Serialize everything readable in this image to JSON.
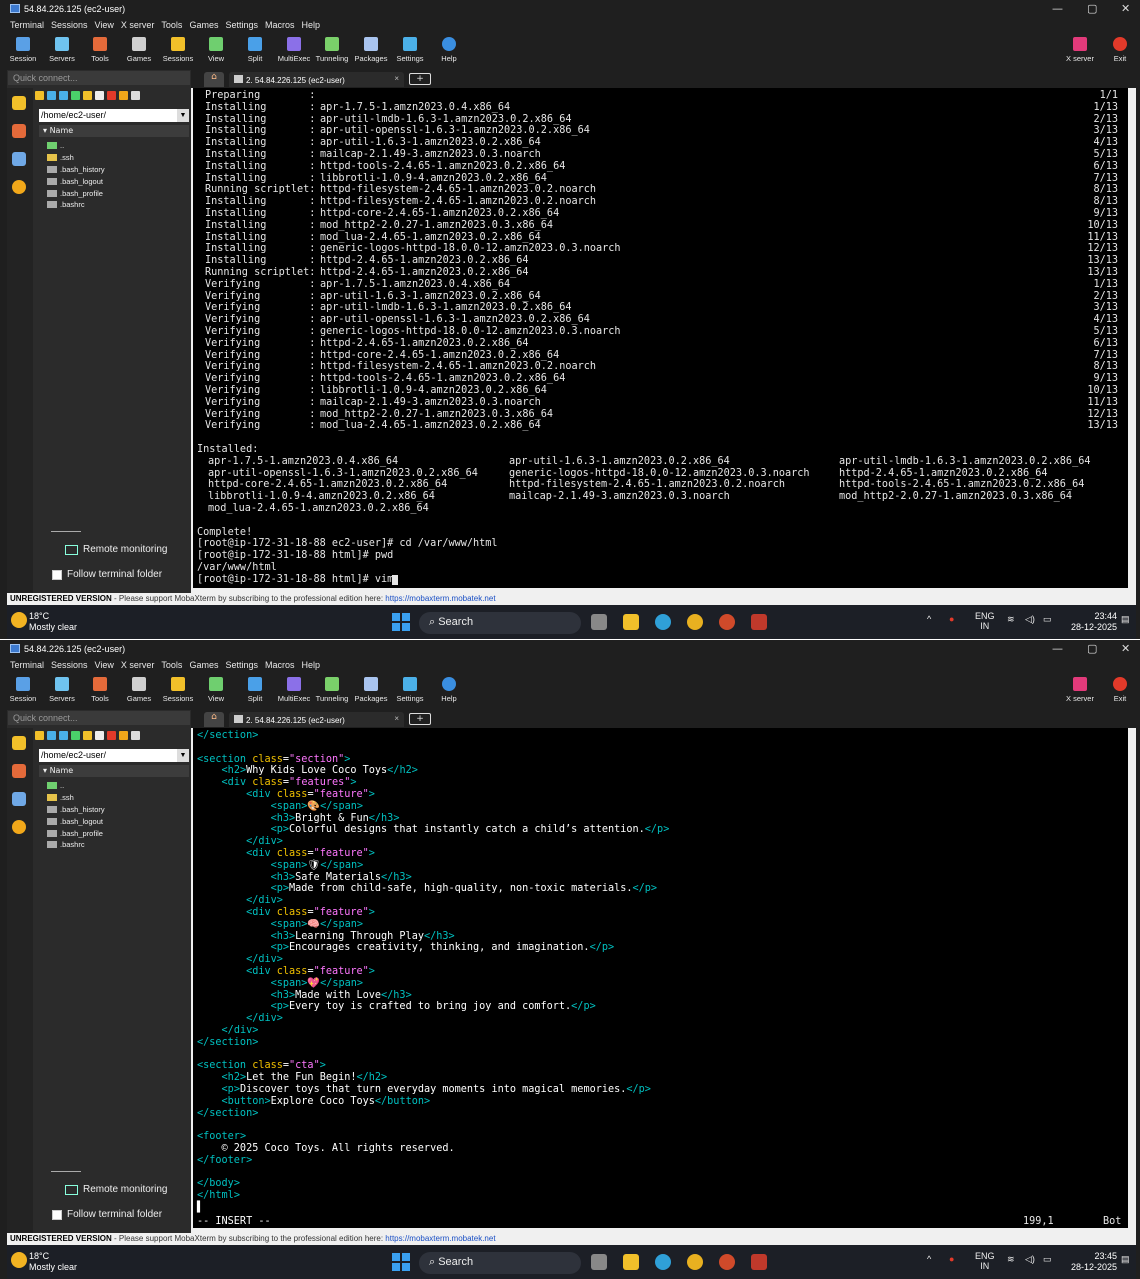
{
  "window": {
    "title": "54.84.226.125 (ec2-user)",
    "min": "—",
    "max": "▢",
    "close": "✕"
  },
  "menu": [
    "Terminal",
    "Sessions",
    "View",
    "X server",
    "Tools",
    "Games",
    "Settings",
    "Macros",
    "Help"
  ],
  "toolbar": {
    "items": [
      {
        "label": "Session",
        "icon": "session-icon",
        "color": "#5aa0e6"
      },
      {
        "label": "Servers",
        "icon": "servers-icon",
        "color": "#6fc3ef"
      },
      {
        "label": "Tools",
        "icon": "tools-icon",
        "color": "#e46a3a"
      },
      {
        "label": "Games",
        "icon": "games-icon",
        "color": "#cfcfcf"
      },
      {
        "label": "Sessions",
        "icon": "star-icon",
        "color": "#f2c02a"
      },
      {
        "label": "View",
        "icon": "view-icon",
        "color": "#6fcf6f"
      },
      {
        "label": "Split",
        "icon": "split-icon",
        "color": "#4aa0e8"
      },
      {
        "label": "MultiExec",
        "icon": "multiexec-icon",
        "color": "#8b70e8"
      },
      {
        "label": "Tunneling",
        "icon": "tunneling-icon",
        "color": "#7ad06a"
      },
      {
        "label": "Packages",
        "icon": "packages-icon",
        "color": "#a9c4ef"
      },
      {
        "label": "Settings",
        "icon": "settings-icon",
        "color": "#4bb0e8"
      },
      {
        "label": "Help",
        "icon": "help-icon",
        "color": "#3a8ee0"
      }
    ],
    "xserver": "X server",
    "exit": "Exit"
  },
  "sidebar": {
    "quick_connect": "Quick connect...",
    "path": "/home/ec2-user/",
    "name_col": "Name",
    "files": [
      "..",
      ".ssh",
      ".bash_history",
      ".bash_logout",
      ".bash_profile",
      ".bashrc"
    ],
    "remote_monitoring": "Remote monitoring",
    "follow_folder": "Follow terminal folder"
  },
  "tab": {
    "label": "2. 54.84.226.125 (ec2-user)",
    "close": "×",
    "plus": "+"
  },
  "banner": {
    "bold": "UNREGISTERED VERSION",
    "text": " -  Please support MobaXterm by subscribing to the professional edition here:  ",
    "link": "https://mobaxterm.mobatek.net"
  },
  "taskbar": {
    "temp": "18°C",
    "weather": "Mostly clear",
    "search": "Search",
    "lang1": "ENG",
    "lang2": "IN",
    "time1": "23:44",
    "time2": "23:45",
    "date": "28-12-2025"
  },
  "term1": {
    "rows": [
      {
        "a": "Preparing        :",
        "b": "",
        "c": "1/1"
      },
      {
        "a": "Installing       :",
        "b": "apr-1.7.5-1.amzn2023.0.4.x86_64",
        "c": "1/13"
      },
      {
        "a": "Installing       :",
        "b": "apr-util-lmdb-1.6.3-1.amzn2023.0.2.x86_64",
        "c": "2/13"
      },
      {
        "a": "Installing       :",
        "b": "apr-util-openssl-1.6.3-1.amzn2023.0.2.x86_64",
        "c": "3/13"
      },
      {
        "a": "Installing       :",
        "b": "apr-util-1.6.3-1.amzn2023.0.2.x86_64",
        "c": "4/13"
      },
      {
        "a": "Installing       :",
        "b": "mailcap-2.1.49-3.amzn2023.0.3.noarch",
        "c": "5/13"
      },
      {
        "a": "Installing       :",
        "b": "httpd-tools-2.4.65-1.amzn2023.0.2.x86_64",
        "c": "6/13"
      },
      {
        "a": "Installing       :",
        "b": "libbrotli-1.0.9-4.amzn2023.0.2.x86_64",
        "c": "7/13"
      },
      {
        "a": "Running scriptlet:",
        "b": "httpd-filesystem-2.4.65-1.amzn2023.0.2.noarch",
        "c": "8/13"
      },
      {
        "a": "Installing       :",
        "b": "httpd-filesystem-2.4.65-1.amzn2023.0.2.noarch",
        "c": "8/13"
      },
      {
        "a": "Installing       :",
        "b": "httpd-core-2.4.65-1.amzn2023.0.2.x86_64",
        "c": "9/13"
      },
      {
        "a": "Installing       :",
        "b": "mod_http2-2.0.27-1.amzn2023.0.3.x86_64",
        "c": "10/13"
      },
      {
        "a": "Installing       :",
        "b": "mod_lua-2.4.65-1.amzn2023.0.2.x86_64",
        "c": "11/13"
      },
      {
        "a": "Installing       :",
        "b": "generic-logos-httpd-18.0.0-12.amzn2023.0.3.noarch",
        "c": "12/13"
      },
      {
        "a": "Installing       :",
        "b": "httpd-2.4.65-1.amzn2023.0.2.x86_64",
        "c": "13/13"
      },
      {
        "a": "Running scriptlet:",
        "b": "httpd-2.4.65-1.amzn2023.0.2.x86_64",
        "c": "13/13"
      },
      {
        "a": "Verifying        :",
        "b": "apr-1.7.5-1.amzn2023.0.4.x86_64",
        "c": "1/13"
      },
      {
        "a": "Verifying        :",
        "b": "apr-util-1.6.3-1.amzn2023.0.2.x86_64",
        "c": "2/13"
      },
      {
        "a": "Verifying        :",
        "b": "apr-util-lmdb-1.6.3-1.amzn2023.0.2.x86_64",
        "c": "3/13"
      },
      {
        "a": "Verifying        :",
        "b": "apr-util-openssl-1.6.3-1.amzn2023.0.2.x86_64",
        "c": "4/13"
      },
      {
        "a": "Verifying        :",
        "b": "generic-logos-httpd-18.0.0-12.amzn2023.0.3.noarch",
        "c": "5/13"
      },
      {
        "a": "Verifying        :",
        "b": "httpd-2.4.65-1.amzn2023.0.2.x86_64",
        "c": "6/13"
      },
      {
        "a": "Verifying        :",
        "b": "httpd-core-2.4.65-1.amzn2023.0.2.x86_64",
        "c": "7/13"
      },
      {
        "a": "Verifying        :",
        "b": "httpd-filesystem-2.4.65-1.amzn2023.0.2.noarch",
        "c": "8/13"
      },
      {
        "a": "Verifying        :",
        "b": "httpd-tools-2.4.65-1.amzn2023.0.2.x86_64",
        "c": "9/13"
      },
      {
        "a": "Verifying        :",
        "b": "libbrotli-1.0.9-4.amzn2023.0.2.x86_64",
        "c": "10/13"
      },
      {
        "a": "Verifying        :",
        "b": "mailcap-2.1.49-3.amzn2023.0.3.noarch",
        "c": "11/13"
      },
      {
        "a": "Verifying        :",
        "b": "mod_http2-2.0.27-1.amzn2023.0.3.x86_64",
        "c": "12/13"
      },
      {
        "a": "Verifying        :",
        "b": "mod_lua-2.4.65-1.amzn2023.0.2.x86_64",
        "c": "13/13"
      }
    ],
    "installed_label": "Installed:",
    "installed": [
      [
        "apr-1.7.5-1.amzn2023.0.4.x86_64",
        "apr-util-1.6.3-1.amzn2023.0.2.x86_64",
        "apr-util-lmdb-1.6.3-1.amzn2023.0.2.x86_64"
      ],
      [
        "apr-util-openssl-1.6.3-1.amzn2023.0.2.x86_64",
        "generic-logos-httpd-18.0.0-12.amzn2023.0.3.noarch",
        "httpd-2.4.65-1.amzn2023.0.2.x86_64"
      ],
      [
        "httpd-core-2.4.65-1.amzn2023.0.2.x86_64",
        "httpd-filesystem-2.4.65-1.amzn2023.0.2.noarch",
        "httpd-tools-2.4.65-1.amzn2023.0.2.x86_64"
      ],
      [
        "libbrotli-1.0.9-4.amzn2023.0.2.x86_64",
        "mailcap-2.1.49-3.amzn2023.0.3.noarch",
        "mod_http2-2.0.27-1.amzn2023.0.3.x86_64"
      ],
      [
        "mod_lua-2.4.65-1.amzn2023.0.2.x86_64",
        "",
        ""
      ]
    ],
    "tail": [
      "Complete!",
      "[root@ip-172-31-18-88 ec2-user]# cd /var/www/html",
      "[root@ip-172-31-18-88 html]# pwd",
      "/var/www/html",
      "[root@ip-172-31-18-88 html]# vim "
    ]
  },
  "term2": {
    "lines": [
      "</section>",
      "",
      "<section class=\"section\">",
      "    <h2>Why Kids Love Coco Toys</h2>",
      "    <div class=\"features\">",
      "        <div class=\"feature\">",
      "            <span>🎨</span>",
      "            <h3>Bright & Fun</h3>",
      "            <p>Colorful designs that instantly catch a child’s attention.</p>",
      "        </div>",
      "        <div class=\"feature\">",
      "            <span>🛡</span>",
      "            <h3>Safe Materials</h3>",
      "            <p>Made from child-safe, high-quality, non-toxic materials.</p>",
      "        </div>",
      "        <div class=\"feature\">",
      "            <span>🧠</span>",
      "            <h3>Learning Through Play</h3>",
      "            <p>Encourages creativity, thinking, and imagination.</p>",
      "        </div>",
      "        <div class=\"feature\">",
      "            <span>💖</span>",
      "            <h3>Made with Love</h3>",
      "            <p>Every toy is crafted to bring joy and comfort.</p>",
      "        </div>",
      "    </div>",
      "</section>",
      "",
      "<section class=\"cta\">",
      "    <h2>Let the Fun Begin!</h2>",
      "    <p>Discover toys that turn everyday moments into magical memories.</p>",
      "    <button>Explore Coco Toys</button>",
      "</section>",
      "",
      "<footer>",
      "    © 2025 Coco Toys. All rights reserved.",
      "</footer>",
      "",
      "</body>",
      "</html>",
      "▌"
    ],
    "mode": "-- INSERT --",
    "pos": "199,1",
    "scroll": "Bot"
  }
}
